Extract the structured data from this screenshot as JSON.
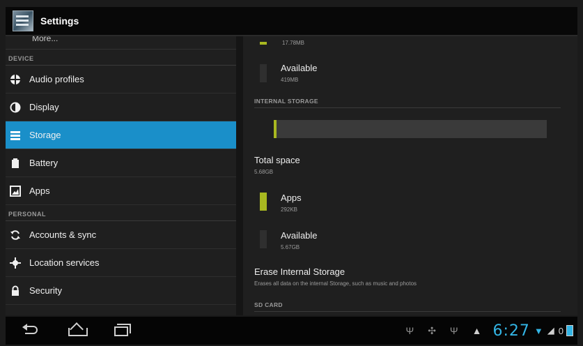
{
  "app": {
    "title": "Settings"
  },
  "left_nav": {
    "cut_off_item": "More...",
    "sections": [
      {
        "header": "DEVICE",
        "items": [
          {
            "label": "Audio profiles",
            "icon": "audio-profiles-icon",
            "active": false
          },
          {
            "label": "Display",
            "icon": "display-icon",
            "active": false
          },
          {
            "label": "Storage",
            "icon": "storage-icon",
            "active": true
          },
          {
            "label": "Battery",
            "icon": "battery-icon",
            "active": false
          },
          {
            "label": "Apps",
            "icon": "apps-icon",
            "active": false
          }
        ]
      },
      {
        "header": "PERSONAL",
        "items": [
          {
            "label": "Accounts & sync",
            "icon": "sync-icon",
            "active": false
          },
          {
            "label": "Location services",
            "icon": "location-icon",
            "active": false
          },
          {
            "label": "Security",
            "icon": "lock-icon",
            "active": false
          }
        ]
      }
    ]
  },
  "storage": {
    "top_partial_value": "17.78MB",
    "top_available": {
      "title": "Available",
      "value": "419MB"
    },
    "internal": {
      "header": "INTERNAL STORAGE",
      "used_fraction": 0.01,
      "total_space_title": "Total space",
      "total_space_value": "5.68GB",
      "apps_title": "Apps",
      "apps_value": "292KB",
      "available_title": "Available",
      "available_value": "5.67GB",
      "erase_title": "Erase Internal Storage",
      "erase_desc": "Erases all data on the internal Storage, such as music and photos"
    },
    "sd_header": "SD CARD"
  },
  "system_bar": {
    "clock": "6:27",
    "buttons": [
      "back-icon",
      "home-icon",
      "recent-apps-icon"
    ],
    "notifications": [
      "usb-icon",
      "android-debug-icon",
      "usb-icon",
      "warning-icon"
    ]
  },
  "colors": {
    "accent": "#33b5e5",
    "selected": "#1a8fc9",
    "apps_legend": "#a8b820"
  }
}
